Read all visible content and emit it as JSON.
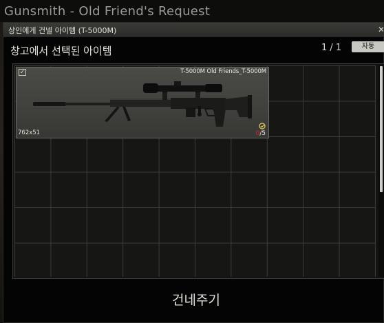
{
  "quest": {
    "title": "Gunsmith - Old Friend's Request"
  },
  "dialog": {
    "title": "상인에게 건넬 아이템 (T-5000M)",
    "stash_label": "창고에서 선택된 아이템",
    "page_indicator": "1 / 1",
    "auto_button_label": "자동",
    "transfer_button_label": "건네주기"
  },
  "item": {
    "name": "T-5000M Old Friends_T-5000M",
    "caliber": "762x51",
    "mag_current": "0",
    "mag_capacity": "/5",
    "selected": true,
    "icon": "bolt-action-sniper-rifle-icon",
    "colors": {
      "magazine_empty": "#d52a1f",
      "item_background": "#454541"
    }
  },
  "grid": {
    "columns": 10,
    "rows": 6
  }
}
